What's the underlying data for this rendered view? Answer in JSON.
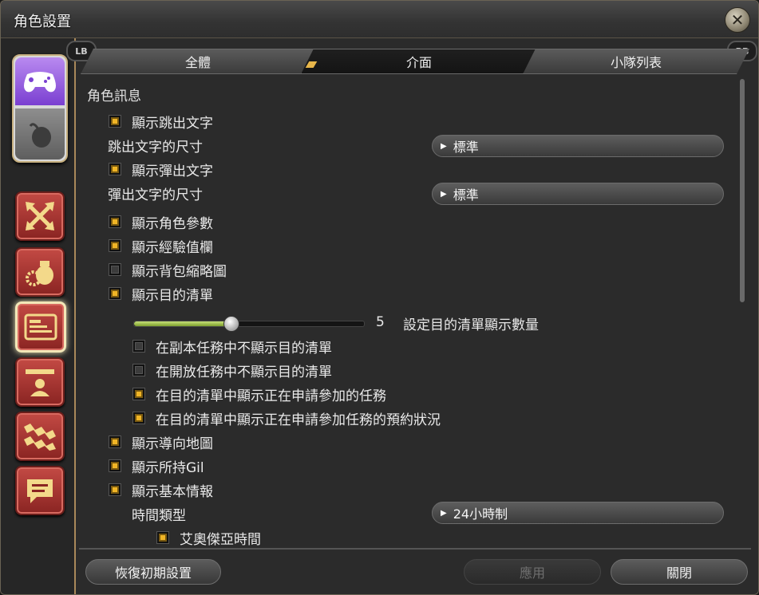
{
  "window": {
    "title": "角色設置"
  },
  "tabs": [
    {
      "label": "全體",
      "active": false
    },
    {
      "label": "介面",
      "active": true
    },
    {
      "label": "小隊列表",
      "active": false
    }
  ],
  "bumpers": {
    "left": "LB",
    "right": "RB"
  },
  "content": {
    "section_title": "角色訊息",
    "items": [
      {
        "label": "顯示跳出文字",
        "checked": true
      },
      {
        "label": "跳出文字的尺寸"
      },
      {
        "label": "顯示彈出文字",
        "checked": true
      },
      {
        "label": "彈出文字的尺寸"
      },
      {
        "label": "顯示角色參數",
        "checked": true
      },
      {
        "label": "顯示經驗值欄",
        "checked": true
      },
      {
        "label": "顯示背包縮略圖",
        "checked": false
      },
      {
        "label": "顯示目的清單",
        "checked": true
      },
      {
        "label": "在副本任務中不顯示目的清單",
        "checked": false
      },
      {
        "label": "在開放任務中不顯示目的清單",
        "checked": false
      },
      {
        "label": "在目的清單中顯示正在申請參加的任務",
        "checked": true
      },
      {
        "label": "在目的清單中顯示正在申請參加任務的預約狀況",
        "checked": true
      },
      {
        "label": "顯示導向地圖",
        "checked": true
      },
      {
        "label": "顯示所持Gil",
        "checked": true
      },
      {
        "label": "顯示基本情報",
        "checked": true
      },
      {
        "label": "時間類型"
      },
      {
        "label": "艾奧傑亞時間",
        "checked": true
      }
    ],
    "dropdowns": {
      "popup_size": "標準",
      "flytext_size": "標準",
      "time_type": "24小時制"
    },
    "slider": {
      "value": "5",
      "fraction": 0.42,
      "label": "設定目的清單顯示數量"
    }
  },
  "footer": {
    "reset": "恢復初期設置",
    "apply": "應用",
    "close": "關閉"
  },
  "colors": {
    "accent": "#f0b526",
    "active_tab": "#141414",
    "rail_button": "#a8332e"
  }
}
